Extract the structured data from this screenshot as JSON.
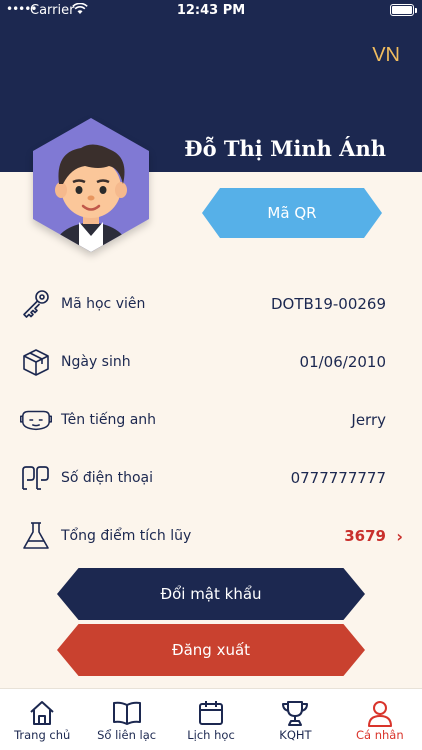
{
  "status": {
    "carrier": "Carrier",
    "time": "12:43 PM"
  },
  "header": {
    "language": "VN"
  },
  "profile": {
    "name": "Đỗ Thị Minh Ánh",
    "qr_label": "Mã QR"
  },
  "info": [
    {
      "label": "Mã học viên",
      "value": "DOTB19-00269",
      "icon": "key-icon"
    },
    {
      "label": "Ngày sinh",
      "value": "01/06/2010",
      "icon": "gift-box-icon"
    },
    {
      "label": "Tên tiếng anh",
      "value": "Jerry",
      "icon": "mask-icon"
    },
    {
      "label": "Số điện thoại",
      "value": "0777777777",
      "icon": "phone-contacts-icon"
    },
    {
      "label": "Tổng điểm tích lũy",
      "value": "3679",
      "icon": "flask-icon"
    }
  ],
  "actions": {
    "change_password": "Đổi mật khẩu",
    "logout": "Đăng xuất"
  },
  "tabs": [
    {
      "label": "Trang chủ",
      "icon": "home-icon"
    },
    {
      "label": "Sổ liên lạc",
      "icon": "book-icon"
    },
    {
      "label": "Lịch học",
      "icon": "calendar-icon"
    },
    {
      "label": "KQHT",
      "icon": "trophy-icon"
    },
    {
      "label": "Cá nhân",
      "icon": "user-icon",
      "active": true
    }
  ],
  "colors": {
    "navy": "#1c2850",
    "cream": "#fcf5ec",
    "blue": "#56b0e8",
    "red": "#c9412f",
    "gold": "#f1bd5f"
  }
}
